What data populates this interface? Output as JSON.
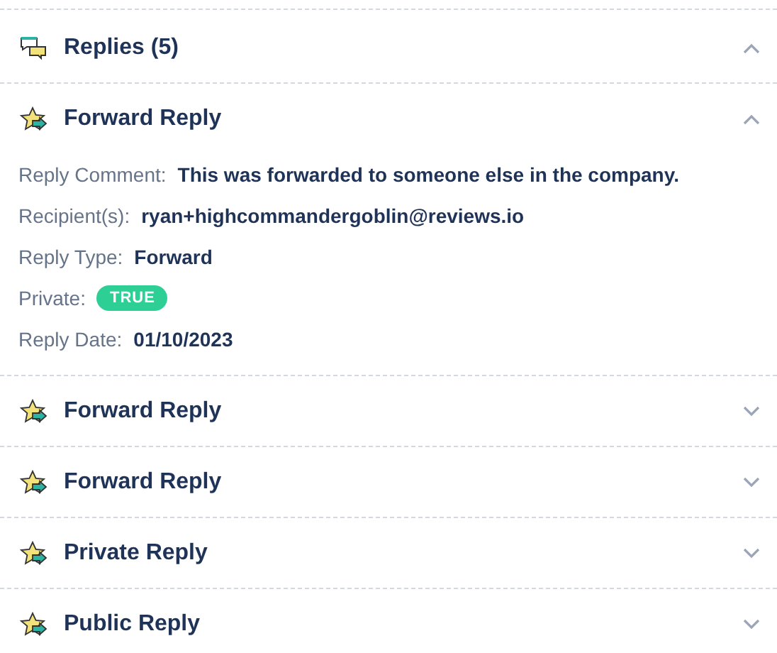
{
  "header": {
    "title": "Replies (5)",
    "expanded": true
  },
  "replies": [
    {
      "title": "Forward Reply",
      "expanded": true,
      "details": [
        {
          "kind": "text",
          "label": "Reply Comment:",
          "value": "This was forwarded to someone else in the company."
        },
        {
          "kind": "text",
          "label": "Recipient(s):",
          "value": "ryan+highcommandergoblin@reviews.io"
        },
        {
          "kind": "text",
          "label": "Reply Type:",
          "value": "Forward"
        },
        {
          "kind": "badge",
          "label": "Private:",
          "value": "TRUE"
        },
        {
          "kind": "text",
          "label": "Reply Date:",
          "value": "01/10/2023"
        }
      ]
    },
    {
      "title": "Forward Reply",
      "expanded": false
    },
    {
      "title": "Forward Reply",
      "expanded": false
    },
    {
      "title": "Private Reply",
      "expanded": false
    },
    {
      "title": "Public Reply",
      "expanded": false
    }
  ]
}
